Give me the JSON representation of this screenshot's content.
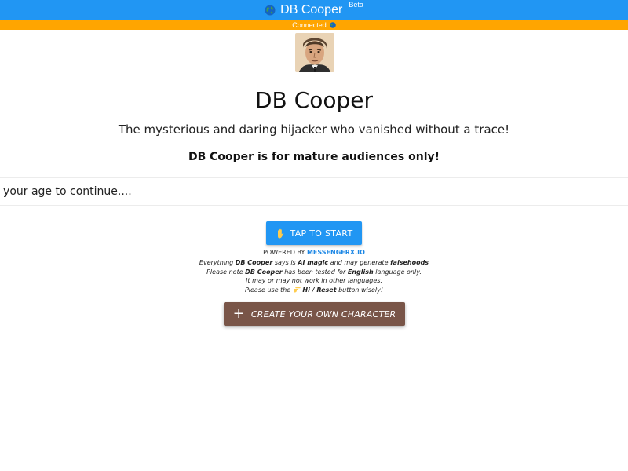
{
  "header": {
    "globe_icon": "globe-icon",
    "title": "DB Cooper",
    "badge": "Beta",
    "accent_color": "#2196f3"
  },
  "status": {
    "text": "Connected",
    "icon": "globe-icon",
    "bar_color": "#ffa500"
  },
  "profile": {
    "avatar": "portrait-avatar",
    "name": "DB Cooper",
    "tagline": "The mysterious and daring hijacker who vanished without a trace!",
    "warning": "DB Cooper is for mature audiences only!"
  },
  "age_prompt": {
    "placeholder": "Enter your age to continue...."
  },
  "start_button": {
    "icon": "raised-hand-icon",
    "label": "TAP TO START",
    "color": "#2196f3"
  },
  "powered": {
    "prefix": "POWERED BY",
    "brand": "MESSENGERX.IO"
  },
  "notes": {
    "line1_a": "Everything",
    "line1_name": "DB Cooper",
    "line1_b": "says is",
    "line1_ai": "AI magic",
    "line1_c": "and may generate",
    "line1_false": "falsehoods",
    "line2_a": "Please note",
    "line2_name": "DB Cooper",
    "line2_b": "has been tested for",
    "line2_lang": "English",
    "line2_c": "language only.",
    "line3": "It may or may not work in other languages.",
    "line4_a": "Please use the",
    "line4_icon": "pointing-hand-icon",
    "line4_btn": "Hi / Reset",
    "line4_c": "button wisely!"
  },
  "create_button": {
    "icon": "plus-icon",
    "label": "CREATE YOUR OWN CHARACTER",
    "color": "#795548"
  }
}
